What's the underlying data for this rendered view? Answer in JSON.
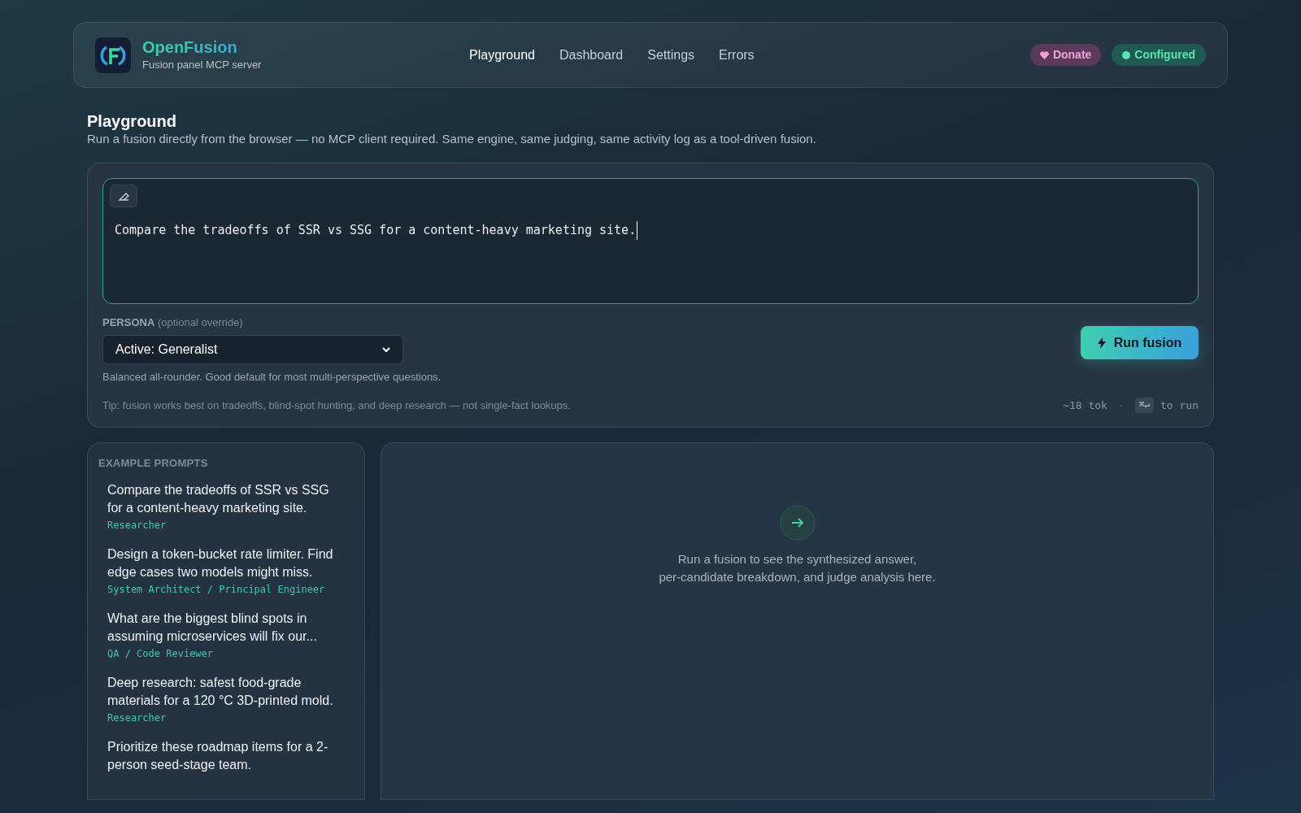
{
  "brand": {
    "name": "OpenFusion",
    "subtitle": "Fusion panel MCP server"
  },
  "nav": [
    {
      "label": "Playground",
      "selected": true
    },
    {
      "label": "Dashboard",
      "selected": false
    },
    {
      "label": "Settings",
      "selected": false
    },
    {
      "label": "Errors",
      "selected": false
    }
  ],
  "header_badges": [
    {
      "kind": "donate",
      "label": "Donate"
    },
    {
      "kind": "status",
      "label": "Configured"
    }
  ],
  "page": {
    "title": "Playground",
    "description": "Run a fusion directly from the browser — no MCP client required. Same engine, same judging, same activity log as a tool-driven fusion."
  },
  "prompt": {
    "value": "Compare the tradeoffs of SSR vs SSG for a content-heavy marketing site."
  },
  "persona": {
    "label": "PERSONA",
    "hint": "(optional override)",
    "value": "Active: Generalist",
    "description": "Balanced all-rounder. Good default for most multi-perspective questions."
  },
  "run_button": "Run fusion",
  "tip": "Tip: fusion works best on tradeoffs, blind-spot hunting, and deep research — not single-fact lookups.",
  "token_count": "~18 tok",
  "separator": "·",
  "shortcut": {
    "key": "⌘↵",
    "text": "to run"
  },
  "examples": {
    "title": "EXAMPLE PROMPTS",
    "items": [
      {
        "text": "Compare the tradeoffs of SSR vs SSG for a content-heavy marketing site.",
        "persona": "Researcher"
      },
      {
        "text": "Design a token-bucket rate limiter. Find edge cases two models might miss.",
        "persona": "System Architect / Principal Engineer"
      },
      {
        "text": "What are the biggest blind spots in assuming microservices will fix our...",
        "persona": "QA / Code Reviewer"
      },
      {
        "text": "Deep research: safest food-grade materials for a 120 °C 3D-printed mold.",
        "persona": "Researcher"
      },
      {
        "text": "Prioritize these roadmap items for a 2-person seed-stage team."
      }
    ]
  },
  "result_placeholder": {
    "lines": [
      "Run a fusion to see the synthesized answer,",
      "per-candidate breakdown, and judge analysis here."
    ]
  }
}
